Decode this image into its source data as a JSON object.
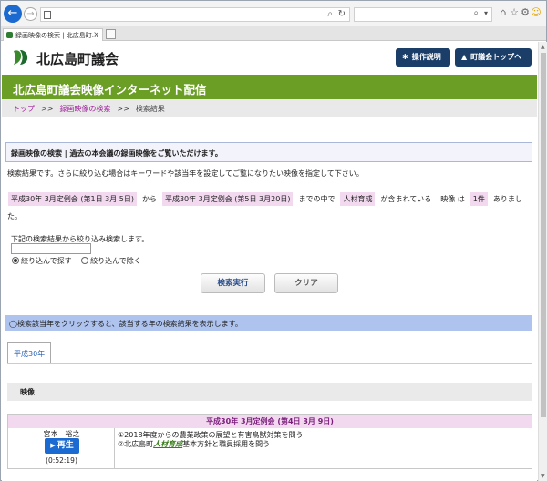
{
  "browser": {
    "tab_title": "録画映像の検索 | 北広島町...",
    "tab_close": "×",
    "url": "",
    "back_glyph": "←",
    "fwd_glyph": "→",
    "refresh_glyph": "↻",
    "search_glyph": "⌕",
    "window_controls": "—  ☐  ✕"
  },
  "header": {
    "site_title": "北広島町議会",
    "manual_button": "操作説明",
    "top_button": "町議会トップへ",
    "brand_color": "#1b3e69"
  },
  "band": {
    "title": "北広島町議会映像インターネット配信",
    "color": "#6b9e24"
  },
  "breadcrumb": {
    "items": [
      "トップ",
      "録画映像の検索",
      "検索結果"
    ],
    "separator": ">>"
  },
  "notice": "録画映像の検索 | 過去の本会議の録画映像をご覧いただけます。",
  "intro": "検索結果です。さらに絞り込む場合はキーワードや該当年を設定してご覧になりたい映像を指定して下さい。",
  "conditions": {
    "from_session": "平成30年 3月定例会 (第1日 3月 5日)",
    "from_word": "から",
    "to_session": "平成30年 3月定例会 (第5日 3月20日)",
    "to_word": "までの中で",
    "keyword": "人材育成",
    "contains_word": "が含まれている",
    "video_word": "映像 は",
    "count": "1件",
    "tail": "ありました。"
  },
  "refine": {
    "label": "下記の検索結果から絞り込み検索します。",
    "input_value": "",
    "option_narrow": "絞り込んで探す",
    "option_exclude": "絞り込んで除く"
  },
  "actions": {
    "search": "検索実行",
    "clear": "クリア"
  },
  "hint": "◯検索該当年をクリックすると、該当する年の検索結果を表示します。",
  "year_tab": "平成30年",
  "video_section": "映像",
  "session": {
    "title": "平成30年 3月定例会 (第4日 3月 9日)",
    "speaker": "宮本　裕之",
    "play_label": "再生",
    "duration": "(0:52:19)",
    "topic_1": "①2018年度からの農業政策の展望と有害鳥獣対策を問う",
    "topic_2_pre": "②北広島町",
    "topic_2_hl": "人材育成",
    "topic_2_post": "基本方針と職員採用を問う"
  }
}
